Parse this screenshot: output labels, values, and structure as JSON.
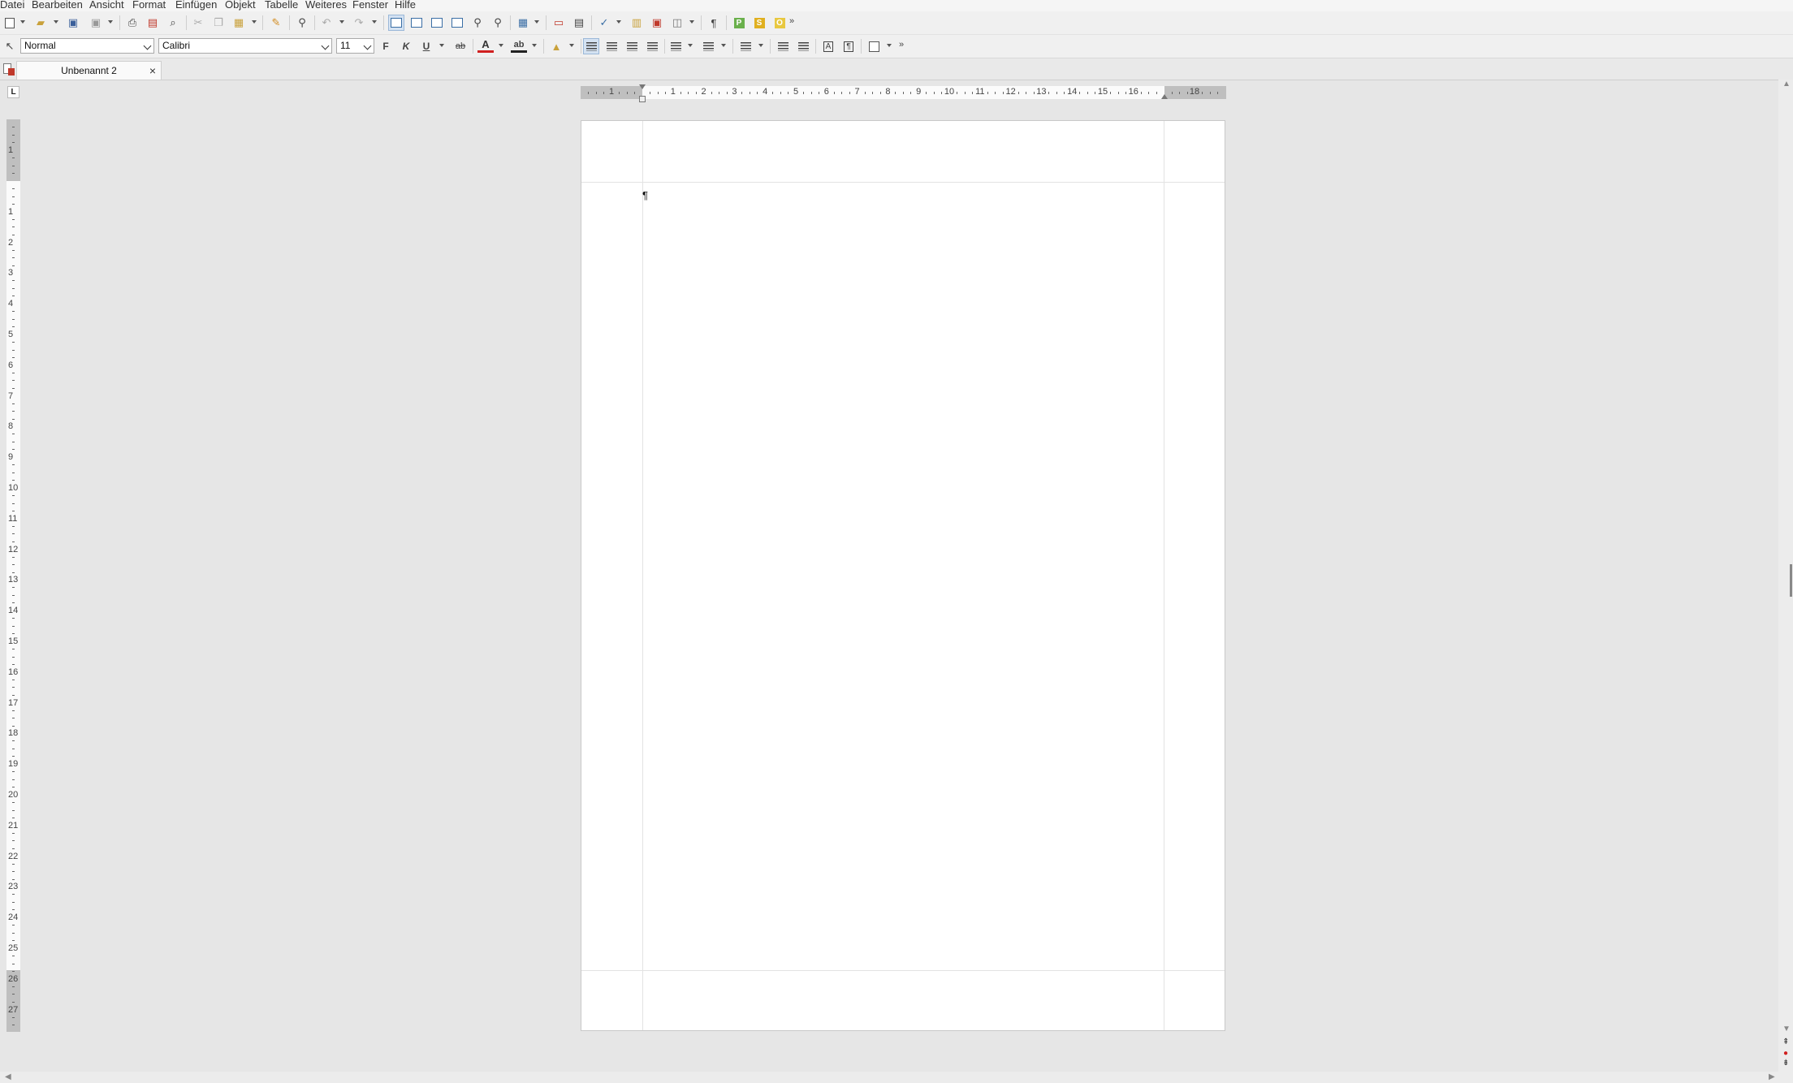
{
  "menu": [
    "Datei",
    "Bearbeiten",
    "Ansicht",
    "Format",
    "Einfügen",
    "Objekt",
    "Tabelle",
    "Weiteres",
    "Fenster",
    "Hilfe"
  ],
  "formatting": {
    "paragraph_style": "Normal",
    "font_name": "Calibri",
    "font_size": "11",
    "bold_label": "F",
    "italic_label": "K",
    "underline_label": "U",
    "strike_label": "ab",
    "font_color_label": "A",
    "highlight_label": "ab",
    "overflow": "»"
  },
  "toolbar": {
    "pilcrow_label": "¶",
    "overflow": "»",
    "p_label": "P",
    "s_label": "S",
    "o_label": "O"
  },
  "tab": {
    "title": "Unbenannt 2",
    "close": "×"
  },
  "document": {
    "pilcrow": "¶"
  },
  "ruler": {
    "h_left_numbers": [
      "1"
    ],
    "h_numbers": [
      "1",
      "2",
      "3",
      "4",
      "5",
      "6",
      "7",
      "8",
      "9",
      "10",
      "11",
      "12",
      "13",
      "14",
      "15",
      "16"
    ],
    "h_end": "18",
    "v_top_numbers": [
      "1"
    ],
    "v_numbers": [
      "1",
      "2",
      "3",
      "4",
      "5",
      "6",
      "7",
      "8",
      "9",
      "10",
      "11",
      "12",
      "13",
      "14",
      "15",
      "16",
      "17",
      "18",
      "19",
      "20",
      "21",
      "22",
      "23",
      "24",
      "25",
      "26",
      "27"
    ]
  },
  "colors": {
    "accent": "#3a6ea5",
    "page": "#ffffff",
    "workspace": "#e6e6e6"
  }
}
